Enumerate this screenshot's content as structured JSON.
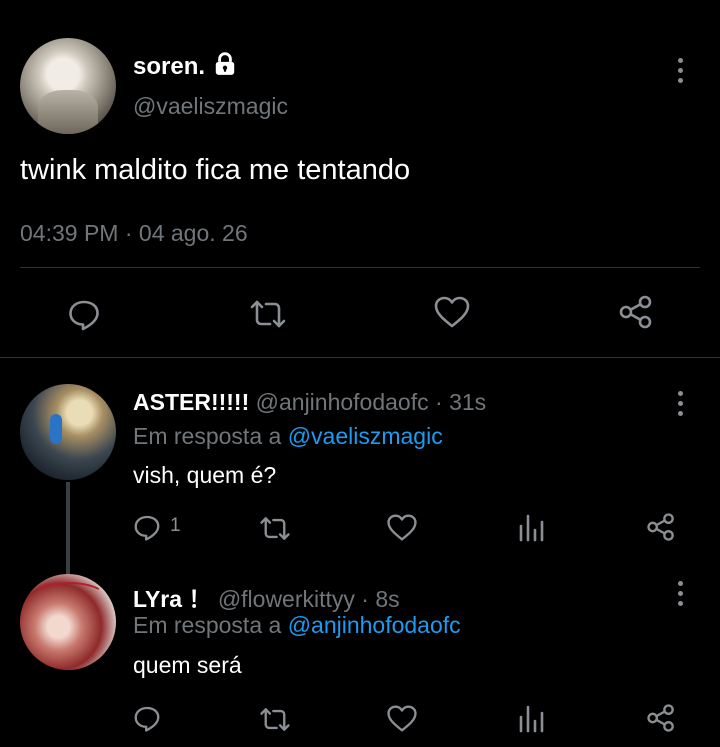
{
  "main_tweet": {
    "display_name": "soren.",
    "handle": "@vaeliszmagic",
    "text": "twink maldito fica me tentando",
    "time": "04:39 PM",
    "separator": "·",
    "date": "04 ago. 26"
  },
  "replies": [
    {
      "display_name": "ASTER!!!!!",
      "handle": "@anjinhofodaofc",
      "age": "· 31s",
      "reply_prefix": "Em resposta a",
      "reply_to": "@vaeliszmagic",
      "text": "vish, quem é?",
      "reply_count": "1"
    },
    {
      "display_name": "LYra ！",
      "handle": "@flowerkittyy",
      "age": "· 8s",
      "reply_prefix": "Em resposta a",
      "reply_to": "@anjinhofodaofc",
      "text": "quem será",
      "reply_count": ""
    }
  ],
  "icons": {
    "lock": "lock-icon",
    "more": "more-vertical-icon",
    "reply": "reply-bubble-icon",
    "retweet": "retweet-icon",
    "like": "heart-icon",
    "share": "share-icon",
    "stats": "stats-icon"
  },
  "colors": {
    "background": "#000000",
    "text": "#e7e9ea",
    "muted": "#71767b",
    "link": "#1d9bf0",
    "divider": "#2f3336"
  }
}
